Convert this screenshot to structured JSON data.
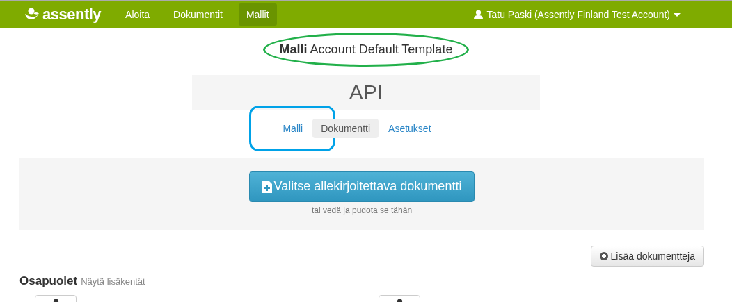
{
  "navbar": {
    "brand": "assently",
    "items": [
      {
        "label": "Aloita",
        "selected": false
      },
      {
        "label": "Dokumentit",
        "selected": false
      },
      {
        "label": "Mallit",
        "selected": true
      }
    ],
    "user": "Tatu Paski (Assently Finland Test Account)"
  },
  "title": {
    "prefix": "Malli",
    "text": "Account Default Template",
    "highlighted": true
  },
  "name_box": "API",
  "tabs": [
    {
      "label": "Malli",
      "selected": false,
      "highlighted": true
    },
    {
      "label": "Dokumentti",
      "selected": true,
      "highlighted": false
    },
    {
      "label": "Asetukset",
      "selected": false,
      "highlighted": false
    }
  ],
  "upload": {
    "button": "Valitse allekirjoitettava dokumentti",
    "hint": "tai vedä ja pudota se tähän"
  },
  "add_documents": "Lisää dokumentteja",
  "parties": {
    "heading": "Osapuolet",
    "link": "Näytä lisäkentät",
    "buttons": [
      {
        "kind": "person"
      },
      {
        "kind": "person"
      }
    ]
  }
}
